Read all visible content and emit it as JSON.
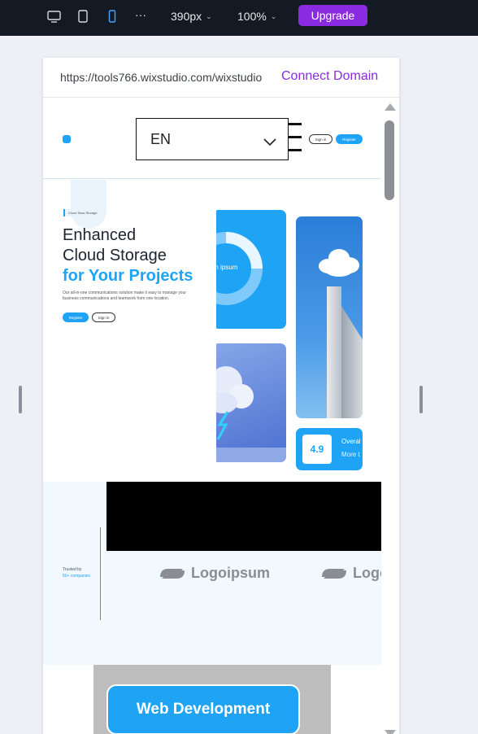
{
  "toolbar": {
    "icons": [
      "desktop-icon",
      "tablet-icon",
      "mobile-icon",
      "more-icon"
    ],
    "more_label": "···",
    "width_value": "390px",
    "zoom_value": "100%",
    "upgrade_label": "Upgrade"
  },
  "preview": {
    "url": "https://tools766.wixstudio.com/wixstudio",
    "connect_domain_label": "Connect Domain"
  },
  "site": {
    "header": {
      "language": "EN",
      "sign_in_label": "Sign in",
      "register_label": "Register"
    },
    "hero": {
      "tag": "Cloud Sass Storage",
      "title_line1": "Enhanced",
      "title_line2": "Cloud Storage",
      "title_line3": "for Your Projects",
      "description": "Our all-in-one communications solution make it easy to manage your business communications and teamwork from one location.",
      "register_label": "Register",
      "sign_in_label": "Sign in",
      "ring_label": "rem ipsum",
      "rating": "4.9",
      "overall_label": "Overal",
      "more_label": "More t"
    },
    "trusted": {
      "label": "Trusted by",
      "count": "50+ companies",
      "brands": [
        "Logoipsum",
        "Logo"
      ]
    },
    "services": {
      "web_development_label": "Web Development"
    }
  },
  "colors": {
    "toolbar_bg": "#141a24",
    "accent_purple": "#8a2be2",
    "brand_blue": "#1fa3f5"
  }
}
